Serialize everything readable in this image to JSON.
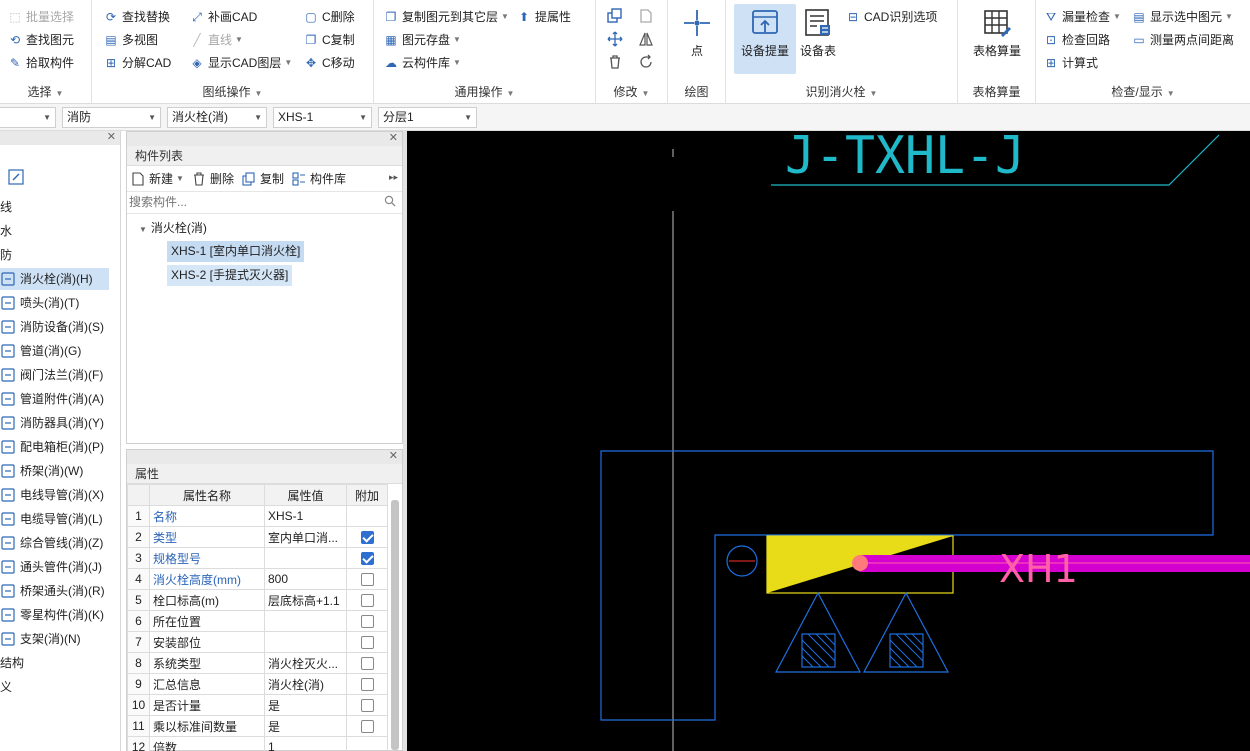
{
  "ribbon": {
    "select_group": {
      "label": "选择",
      "items": [
        "批量选择",
        "查找图元",
        "拾取构件"
      ]
    },
    "drawing_group": {
      "label": "图纸操作",
      "items": [
        "查找替换",
        "多视图",
        "分解CAD",
        "补画CAD",
        "直线",
        "显示CAD图层",
        "C删除",
        "C复制",
        "C移动"
      ]
    },
    "common_group": {
      "label": "通用操作",
      "items": [
        "复制图元到其它层",
        "提属性",
        "图元存盘",
        "云构件库"
      ]
    },
    "modify_group": {
      "label": "修改"
    },
    "draw_group": {
      "label": "绘图",
      "point_label": "点"
    },
    "identify_group": {
      "label": "识别消火栓",
      "extract_label": "设备提量",
      "table_label": "设备表",
      "cad_option_label": "CAD识别选项"
    },
    "table_calc_group": {
      "label": "表格算量",
      "button_label": "表格算量"
    },
    "check_group": {
      "label": "检查/显示",
      "items": [
        "漏量检查",
        "显示选中图元",
        "检查回路",
        "测量两点间距离",
        "计算式"
      ]
    }
  },
  "combos": [
    {
      "value": ""
    },
    {
      "value": "消防"
    },
    {
      "value": "消火栓(消)"
    },
    {
      "value": "XHS-1"
    },
    {
      "value": "分层1"
    }
  ],
  "nav": {
    "fragments": [
      "线",
      "水",
      "防"
    ],
    "items": [
      "消火栓(消)(H)",
      "喷头(消)(T)",
      "消防设备(消)(S)",
      "管道(消)(G)",
      "阀门法兰(消)(F)",
      "管道附件(消)(A)",
      "消防器具(消)(Y)",
      "配电箱柜(消)(P)",
      "桥架(消)(W)",
      "电线导管(消)(X)",
      "电缆导管(消)(L)",
      "综合管线(消)(Z)",
      "通头管件(消)(J)",
      "桥架通头(消)(R)",
      "零星构件(消)(K)",
      "支架(消)(N)"
    ],
    "tail_fragments": [
      "结构",
      "义"
    ]
  },
  "component_list": {
    "title": "构件列表",
    "toolbar": [
      "新建",
      "删除",
      "复制",
      "构件库"
    ],
    "search_placeholder": "搜索构件...",
    "root": "消火栓(消)",
    "items": [
      "XHS-1 [室内单口消火栓]",
      "XHS-2 [手提式灭火器]"
    ]
  },
  "properties": {
    "title": "属性",
    "headers": [
      "属性名称",
      "属性值",
      "附加"
    ],
    "rows": [
      {
        "n": "1",
        "name": "名称",
        "value": "XHS-1",
        "blue": true,
        "check": "none"
      },
      {
        "n": "2",
        "name": "类型",
        "value": "室内单口消...",
        "blue": true,
        "check": "on"
      },
      {
        "n": "3",
        "name": "规格型号",
        "value": "",
        "blue": true,
        "check": "on"
      },
      {
        "n": "4",
        "name": "消火栓高度(mm)",
        "value": "800",
        "blue": true,
        "check": "off"
      },
      {
        "n": "5",
        "name": "栓口标高(m)",
        "value": "层底标高+1.1",
        "blue": false,
        "check": "off"
      },
      {
        "n": "6",
        "name": "所在位置",
        "value": "",
        "blue": false,
        "check": "off"
      },
      {
        "n": "7",
        "name": "安装部位",
        "value": "",
        "blue": false,
        "check": "off"
      },
      {
        "n": "8",
        "name": "系统类型",
        "value": "消火栓灭火...",
        "blue": false,
        "check": "off"
      },
      {
        "n": "9",
        "name": "汇总信息",
        "value": "消火栓(消)",
        "blue": false,
        "check": "off"
      },
      {
        "n": "10",
        "name": "是否计量",
        "value": "是",
        "blue": false,
        "check": "off"
      },
      {
        "n": "11",
        "name": "乘以标准间数量",
        "value": "是",
        "blue": false,
        "check": "off"
      },
      {
        "n": "12",
        "name": "倍数",
        "value": "1",
        "blue": false,
        "check": "none"
      }
    ]
  },
  "cad": {
    "top_text": "J-TXHL-J",
    "pipe_label": "XH1",
    "colors": {
      "blue": "#1f6fe0",
      "cyan": "#1fb9c9",
      "yellow": "#e8dc18",
      "magenta": "#d400d0",
      "pink": "#ff60a8"
    }
  }
}
